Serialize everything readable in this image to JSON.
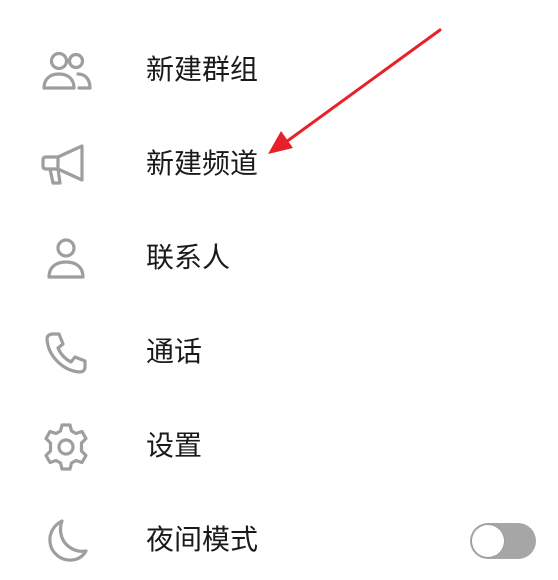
{
  "colors": {
    "icon": "#9e9e9e",
    "text": "#1a1a1a",
    "toggle_off": "#a6a6a6",
    "annotation_arrow": "#e8202a"
  },
  "menu": {
    "items": [
      {
        "icon": "users-icon",
        "label": "新建群组"
      },
      {
        "icon": "megaphone-icon",
        "label": "新建频道"
      },
      {
        "icon": "user-icon",
        "label": "联系人"
      },
      {
        "icon": "phone-icon",
        "label": "通话"
      },
      {
        "icon": "gear-icon",
        "label": "设置"
      },
      {
        "icon": "moon-icon",
        "label": "夜间模式",
        "toggle": false
      }
    ]
  }
}
